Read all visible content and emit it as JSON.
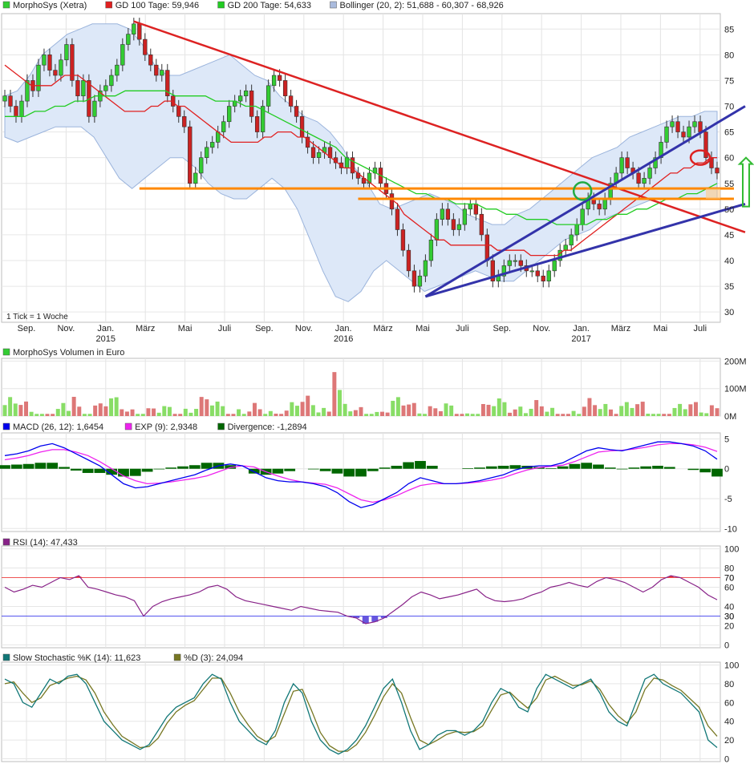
{
  "colors": {
    "price_up": "#33cc33",
    "price_down": "#cc2222",
    "gd100": "#e02020",
    "gd200": "#22cc22",
    "bollinger_fill": "#dde8f8",
    "bollinger_line": "#9bb4dc",
    "trend_red": "#dd2222",
    "trend_blue": "#3333aa",
    "support_orange": "#ff8800",
    "macd": "#0000ee",
    "exp": "#ee22ee",
    "divergence": "#006600",
    "rsi": "#882288",
    "rsi_band": "#5555ee",
    "stoch_k": "#117777",
    "stoch_d": "#777722",
    "volume_up": "#88dd66",
    "volume_down": "#dd7777"
  },
  "legends": {
    "price": [
      {
        "label": "MorphoSys (Xetra)",
        "swatch": "#33cc33"
      },
      {
        "label": "GD 100 Tage: 59,946",
        "swatch": "#e02020"
      },
      {
        "label": "GD 200 Tage: 54,633",
        "swatch": "#22cc22"
      },
      {
        "label": "Bollinger (20, 2): 51,688 - 60,307 - 68,926",
        "swatch": "#aabbdd"
      }
    ],
    "volume": [
      {
        "label": "MorphoSys Volumen in Euro",
        "swatch": "#33cc33"
      }
    ],
    "macd": [
      {
        "label": "MACD (26, 12): 1,6454",
        "swatch": "#0000ee"
      },
      {
        "label": "EXP (9): 2,9348",
        "swatch": "#ee22ee"
      },
      {
        "label": "Divergence: -1,2894",
        "swatch": "#006600"
      }
    ],
    "rsi": [
      {
        "label": "RSI (14): 47,433",
        "swatch": "#882288"
      }
    ],
    "stoch": [
      {
        "label": "Slow Stochastic %K (14): 11,623",
        "swatch": "#117777"
      },
      {
        "label": "%D (3): 24,094",
        "swatch": "#777722"
      }
    ]
  },
  "tick_note": "1 Tick = 1 Woche",
  "x_axis": [
    {
      "month": "Sep.",
      "year": ""
    },
    {
      "month": "Nov.",
      "year": ""
    },
    {
      "month": "Jan.",
      "year": "2015"
    },
    {
      "month": "März",
      "year": ""
    },
    {
      "month": "Mai",
      "year": ""
    },
    {
      "month": "Juli",
      "year": ""
    },
    {
      "month": "Sep.",
      "year": ""
    },
    {
      "month": "Nov.",
      "year": ""
    },
    {
      "month": "Jan.",
      "year": "2016"
    },
    {
      "month": "März",
      "year": ""
    },
    {
      "month": "Mai",
      "year": ""
    },
    {
      "month": "Juli",
      "year": ""
    },
    {
      "month": "Sep.",
      "year": ""
    },
    {
      "month": "Nov.",
      "year": ""
    },
    {
      "month": "Jan.",
      "year": "2017"
    },
    {
      "month": "März",
      "year": ""
    },
    {
      "month": "Mai",
      "year": ""
    },
    {
      "month": "Juli",
      "year": ""
    }
  ],
  "chart_data": [
    {
      "type": "line",
      "title": "MorphoSys (Xetra)",
      "y_ticks": [
        "85",
        "80",
        "75",
        "70",
        "65",
        "60",
        "55",
        "50",
        "45",
        "40",
        "35",
        "30"
      ],
      "ylim": [
        28,
        88
      ],
      "series_note": "weekly candlesticks with GD 100, GD 200 and Bollinger (20,2) bands",
      "close": [
        72,
        70,
        68,
        71,
        75,
        73,
        78,
        80,
        77,
        76,
        79,
        82,
        75,
        72,
        75,
        68,
        71,
        73,
        74,
        76,
        78,
        82,
        84,
        86,
        83,
        80,
        78,
        76,
        77,
        72,
        70,
        68,
        66,
        55,
        57,
        60,
        62,
        63,
        65,
        67,
        70,
        71,
        72,
        73,
        68,
        65,
        70,
        74,
        76,
        75,
        72,
        70,
        68,
        64,
        62,
        60,
        61,
        62,
        60,
        59,
        58,
        60,
        57,
        56,
        55,
        57,
        58,
        55,
        53,
        50,
        46,
        42,
        38,
        35,
        37,
        40,
        44,
        48,
        50,
        48,
        46,
        47,
        50,
        51,
        49,
        45,
        40,
        36,
        37,
        39,
        40,
        40,
        39,
        38,
        38,
        37,
        36,
        38,
        40,
        42,
        43,
        45,
        47,
        50,
        52,
        51,
        50,
        52,
        55,
        57,
        60,
        58,
        57,
        55,
        56,
        58,
        60,
        63,
        66,
        67,
        65,
        64,
        66,
        67,
        65,
        60,
        58,
        57
      ],
      "gd100": [
        78,
        77,
        76,
        75,
        74,
        74,
        74,
        74,
        75,
        76,
        76,
        76,
        75,
        74,
        73,
        72,
        71,
        70,
        69,
        69,
        69,
        69,
        70,
        70,
        71,
        71,
        70,
        70,
        69,
        68,
        67,
        66,
        65,
        64,
        63,
        63,
        63,
        63,
        63,
        64,
        64,
        65,
        65,
        65,
        64,
        64,
        63,
        62,
        61,
        60,
        59,
        58,
        58,
        57,
        56,
        55,
        54,
        53,
        52,
        51,
        49,
        48,
        47,
        46,
        45,
        44,
        44,
        43,
        43,
        43,
        43,
        43,
        43,
        43,
        42,
        42,
        42,
        42,
        42,
        41,
        41,
        41,
        41,
        41,
        42,
        42,
        43,
        44,
        45,
        46,
        47,
        48,
        49,
        50,
        51,
        52,
        53,
        54,
        55,
        56,
        57,
        57,
        58,
        58,
        59,
        59,
        60,
        60
      ],
      "gd200": [
        68,
        68,
        68,
        69,
        69,
        70,
        70,
        71,
        71,
        72,
        72,
        72,
        73,
        73,
        73,
        73,
        73,
        72,
        72,
        72,
        72,
        71,
        71,
        71,
        70,
        70,
        69,
        68,
        67,
        66,
        65,
        64,
        63,
        62,
        60,
        59,
        58,
        57,
        56,
        55,
        54,
        53,
        53,
        52,
        52,
        51,
        51,
        51,
        50,
        50,
        49,
        49,
        48,
        48,
        48,
        47,
        47,
        47,
        47,
        48,
        48,
        49,
        49,
        50,
        50,
        51,
        52,
        52,
        53,
        53,
        54,
        55
      ],
      "boll_upper": [
        72,
        73,
        76,
        80,
        82,
        84,
        85,
        86,
        86,
        86,
        85,
        82,
        78,
        76,
        76,
        77,
        78,
        79,
        80,
        78,
        76,
        75,
        72,
        70,
        68,
        67,
        65,
        62,
        58,
        55,
        51,
        50,
        51,
        52,
        53,
        52,
        51,
        49,
        48,
        47,
        47,
        49,
        50,
        52,
        54,
        56,
        58,
        60,
        61,
        62,
        64,
        65,
        66,
        67,
        68,
        68,
        69,
        69
      ],
      "boll_lower": [
        64,
        63,
        64,
        65,
        66,
        66,
        66,
        64,
        60,
        56,
        54,
        56,
        58,
        60,
        60,
        58,
        55,
        53,
        52,
        52,
        54,
        56,
        54,
        50,
        44,
        38,
        33,
        32,
        34,
        38,
        40,
        38,
        36,
        34,
        35,
        36,
        37,
        38,
        37,
        36,
        36,
        38,
        40,
        42,
        44,
        45,
        46,
        48,
        49,
        50,
        51,
        52,
        52,
        52,
        52,
        52,
        52
      ]
    },
    {
      "type": "bar",
      "title": "MorphoSys Volumen in Euro",
      "y_ticks": [
        "200M",
        "100M",
        "0M"
      ],
      "ylim": [
        0,
        200
      ]
    },
    {
      "type": "line",
      "title": "MACD (26, 12)",
      "y_ticks": [
        "5",
        "0",
        "-5",
        "-10"
      ],
      "ylim": [
        -10,
        5
      ],
      "macd": [
        2.2,
        2.5,
        3,
        3.8,
        4.2,
        3.5,
        2.5,
        1.5,
        0.5,
        -1,
        -2.5,
        -3.2,
        -3,
        -2.5,
        -2,
        -1.5,
        -1,
        -0.2,
        0.5,
        0.8,
        0.5,
        -0.5,
        -1.5,
        -2,
        -2.2,
        -2.2,
        -2.5,
        -3,
        -4,
        -5.5,
        -6.5,
        -6,
        -5,
        -4,
        -2.5,
        -1.5,
        -2,
        -2.5,
        -2.5,
        -2.3,
        -2,
        -1.5,
        -1,
        -0.2,
        0.3,
        0.5,
        0.5,
        1,
        2,
        3,
        3.5,
        3.2,
        3,
        3.5,
        4,
        4.5,
        4.5,
        4.2,
        3.8,
        3,
        1.6
      ],
      "exp": [
        1.5,
        1.8,
        2.2,
        2.8,
        3.2,
        3.2,
        2.8,
        2.2,
        1.2,
        0,
        -1.2,
        -2,
        -2.5,
        -2.4,
        -2.2,
        -1.9,
        -1.6,
        -1.2,
        -0.5,
        0.2,
        0.5,
        0.3,
        -0.5,
        -1.2,
        -1.8,
        -2.2,
        -2.4,
        -2.6,
        -3.2,
        -4.2,
        -5.2,
        -5.6,
        -5.2,
        -4.5,
        -3.6,
        -2.8,
        -2.5,
        -2.5,
        -2.5,
        -2.4,
        -2.2,
        -1.9,
        -1.5,
        -0.8,
        -0.2,
        0.2,
        0.4,
        0.6,
        1.2,
        2,
        2.8,
        3,
        3.1,
        3.3,
        3.6,
        4,
        4.2,
        4.2,
        4,
        3.6,
        2.9
      ],
      "divergence": [
        0.6,
        0.7,
        0.8,
        1,
        1,
        0.3,
        -0.3,
        -0.7,
        -0.7,
        -1,
        -1.3,
        -1.2,
        -0.5,
        -0.1,
        0.2,
        0.4,
        0.6,
        1,
        1,
        0.6,
        0,
        -0.8,
        -1,
        -0.8,
        -0.4,
        0,
        -0.1,
        -0.4,
        -0.8,
        -1.3,
        -1.3,
        -0.4,
        0.2,
        0.5,
        1.1,
        1.3,
        0.5,
        0,
        0,
        0.1,
        0.2,
        0.4,
        0.5,
        0.6,
        0.5,
        0.3,
        0.1,
        0.4,
        0.8,
        1,
        0.7,
        0.2,
        -0.1,
        0.2,
        0.4,
        0.5,
        0.3,
        0,
        -0.2,
        -0.6,
        -1.3
      ]
    },
    {
      "type": "line",
      "title": "RSI (14)",
      "y_ticks": [
        "100",
        "80",
        "70",
        "60",
        "40",
        "30",
        "20",
        "0"
      ],
      "ylim": [
        0,
        100
      ],
      "bands": [
        70,
        30
      ],
      "values": [
        60,
        55,
        58,
        62,
        60,
        65,
        70,
        68,
        72,
        60,
        58,
        55,
        52,
        50,
        46,
        30,
        40,
        45,
        48,
        50,
        52,
        55,
        60,
        62,
        58,
        50,
        46,
        44,
        42,
        40,
        38,
        36,
        40,
        38,
        36,
        35,
        34,
        30,
        28,
        22,
        24,
        28,
        35,
        42,
        50,
        55,
        52,
        48,
        50,
        52,
        55,
        58,
        50,
        46,
        45,
        46,
        48,
        52,
        55,
        60,
        62,
        65,
        62,
        60,
        66,
        70,
        68,
        65,
        60,
        55,
        60,
        68,
        72,
        70,
        65,
        60,
        52,
        47
      ]
    },
    {
      "type": "line",
      "title": "Slow Stochastic %K (14)",
      "y_ticks": [
        "100",
        "80",
        "60",
        "40",
        "20",
        "0"
      ],
      "ylim": [
        0,
        100
      ],
      "k": [
        85,
        80,
        60,
        55,
        70,
        85,
        80,
        88,
        90,
        80,
        60,
        40,
        30,
        20,
        15,
        10,
        15,
        30,
        45,
        55,
        60,
        65,
        80,
        90,
        85,
        60,
        40,
        30,
        20,
        15,
        30,
        60,
        80,
        70,
        40,
        20,
        10,
        5,
        10,
        20,
        35,
        55,
        75,
        85,
        60,
        30,
        10,
        15,
        25,
        30,
        30,
        25,
        30,
        40,
        60,
        75,
        70,
        55,
        50,
        75,
        90,
        85,
        80,
        75,
        80,
        85,
        70,
        50,
        40,
        35,
        60,
        85,
        90,
        80,
        75,
        70,
        60,
        50,
        20,
        12
      ],
      "d": [
        80,
        82,
        70,
        60,
        65,
        78,
        82,
        86,
        88,
        84,
        70,
        50,
        36,
        24,
        18,
        12,
        13,
        22,
        38,
        50,
        57,
        62,
        74,
        86,
        86,
        70,
        50,
        36,
        24,
        18,
        24,
        48,
        72,
        74,
        52,
        28,
        14,
        8,
        8,
        15,
        28,
        46,
        66,
        80,
        70,
        44,
        20,
        15,
        20,
        26,
        29,
        28,
        29,
        35,
        52,
        68,
        71,
        62,
        54,
        65,
        84,
        88,
        83,
        78,
        79,
        83,
        74,
        58,
        46,
        38,
        50,
        74,
        86,
        84,
        78,
        73,
        64,
        55,
        35,
        24
      ]
    }
  ]
}
